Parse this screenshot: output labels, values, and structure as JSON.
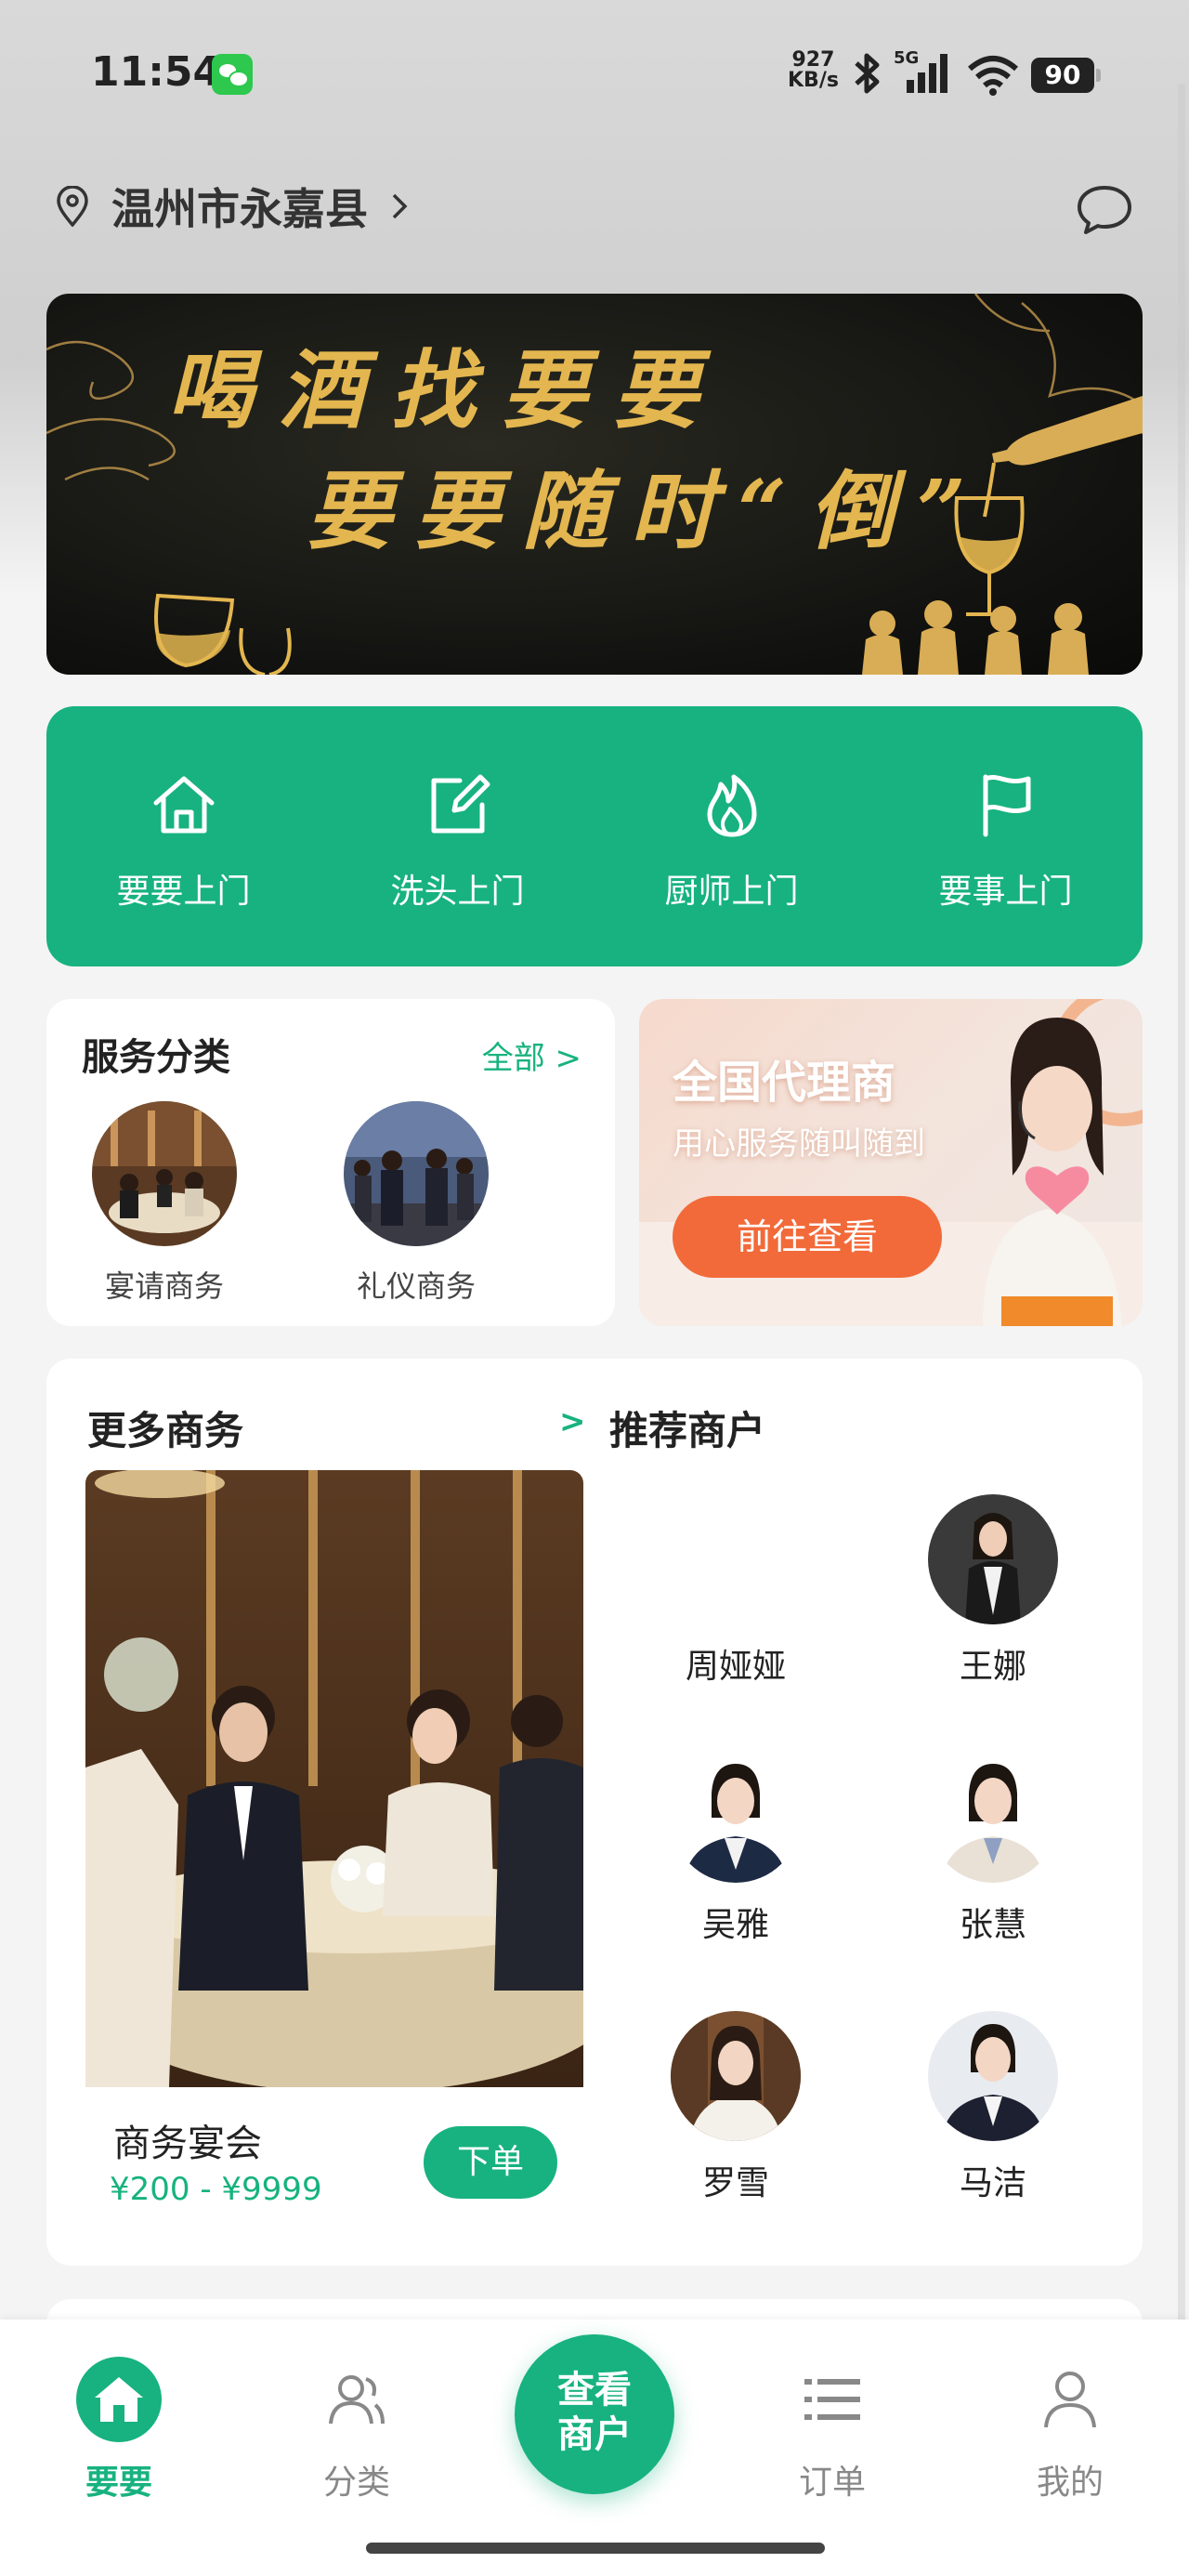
{
  "status_bar": {
    "time": "11:54",
    "net_speed_value": "927",
    "net_speed_unit": "KB/s",
    "network": "5G",
    "battery": "90",
    "icons": [
      "wechat-icon",
      "bluetooth-icon",
      "signal-icon",
      "wifi-icon",
      "battery-icon"
    ]
  },
  "header": {
    "location": "温州市永嘉县",
    "icons": [
      "location-pin-icon",
      "chevron-right-icon",
      "chat-bubble-icon"
    ]
  },
  "banner": {
    "line1": "喝酒找要要",
    "line2": "要要随时“倒”"
  },
  "quick_actions": [
    {
      "label": "要要上门",
      "icon": "home-icon"
    },
    {
      "label": "洗头上门",
      "icon": "edit-icon"
    },
    {
      "label": "厨师上门",
      "icon": "flame-icon"
    },
    {
      "label": "要事上门",
      "icon": "flag-icon"
    }
  ],
  "service_category": {
    "title": "服务分类",
    "all_label": "全部 >",
    "items": [
      {
        "label": "宴请商务"
      },
      {
        "label": "礼仪商务"
      }
    ]
  },
  "agent_promo": {
    "title": "全国代理商",
    "subtitle": "用心服务随叫随到",
    "button": "前往查看"
  },
  "more_business": {
    "title": "更多商务",
    "arrow": ">",
    "feature": {
      "name": "商务宴会",
      "price": "¥200 - ¥9999",
      "button": "下单"
    }
  },
  "recommended": {
    "title": "推荐商户",
    "merchants": [
      {
        "name": "周娅娅"
      },
      {
        "name": "王娜"
      },
      {
        "name": "吴雅"
      },
      {
        "name": "张慧"
      },
      {
        "name": "罗雪"
      },
      {
        "name": "马洁"
      }
    ]
  },
  "bottom_nav": {
    "items": [
      {
        "label": "要要",
        "icon": "home-icon",
        "active": true
      },
      {
        "label": "分类",
        "icon": "users-icon",
        "active": false
      },
      {
        "label": "订单",
        "icon": "list-icon",
        "active": false
      },
      {
        "label": "我的",
        "icon": "person-icon",
        "active": false
      }
    ],
    "center_line1": "查看",
    "center_line2": "商户"
  },
  "colors": {
    "accent": "#17b27f",
    "orange": "#f26a3a",
    "gold": "#e3b64f"
  }
}
